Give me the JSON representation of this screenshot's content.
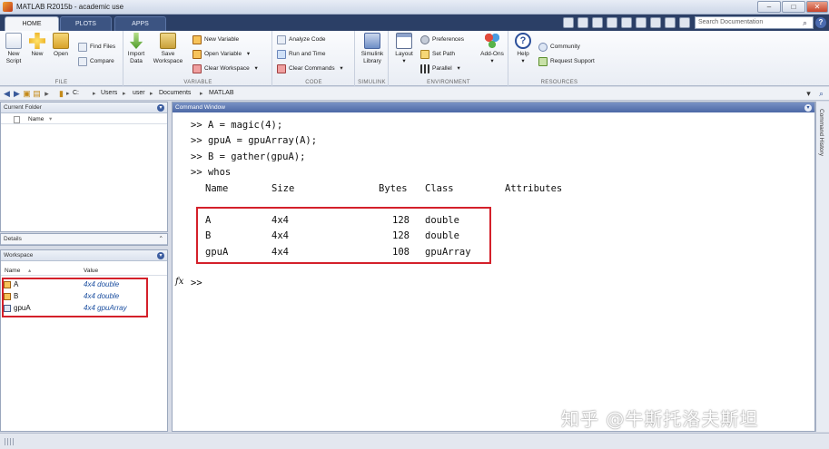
{
  "window": {
    "title": "MATLAB R2015b - academic use",
    "min": "–",
    "max": "□",
    "close": "✕"
  },
  "tabs": [
    {
      "label": "HOME"
    },
    {
      "label": "PLOTS"
    },
    {
      "label": "APPS"
    }
  ],
  "search": {
    "placeholder": "Search Documentation",
    "help": "?"
  },
  "ribbon": {
    "file": {
      "label": "FILE",
      "new_script": "New\nScript",
      "new": "New",
      "open": "Open",
      "find_files": "Find Files",
      "compare": "Compare"
    },
    "variable": {
      "label": "VARIABLE",
      "import_data": "Import\nData",
      "save_workspace": "Save\nWorkspace",
      "new_variable": "New Variable",
      "open_variable": "Open Variable",
      "clear_workspace": "Clear Workspace"
    },
    "code": {
      "label": "CODE",
      "analyze_code": "Analyze Code",
      "run_and_time": "Run and Time",
      "clear_commands": "Clear Commands"
    },
    "simulink": {
      "label": "SIMULINK",
      "library": "Simulink\nLibrary"
    },
    "environment": {
      "label": "ENVIRONMENT",
      "layout": "Layout",
      "preferences": "Preferences",
      "set_path": "Set Path",
      "parallel": "Parallel",
      "add_ons": "Add-Ons"
    },
    "resources": {
      "label": "RESOURCES",
      "help": "Help",
      "community": "Community",
      "request_support": "Request Support"
    }
  },
  "address": {
    "crumbs": [
      "C:",
      "Users",
      "user",
      "Documents",
      "MATLAB"
    ]
  },
  "current_folder": {
    "title": "Current Folder",
    "col_name": "Name"
  },
  "details": {
    "title": "Details"
  },
  "workspace": {
    "title": "Workspace",
    "col_name": "Name",
    "col_value": "Value",
    "rows": [
      {
        "name": "A",
        "value": "4x4 double"
      },
      {
        "name": "B",
        "value": "4x4 double"
      },
      {
        "name": "gpuA",
        "value": "4x4 gpuArray"
      }
    ]
  },
  "command_window": {
    "title": "Command Window",
    "lines": [
      ">> A = magic(4);",
      ">> gpuA = gpuArray(A);",
      ">> B = gather(gpuA);",
      ">> whos"
    ],
    "headers": {
      "name": "Name",
      "size": "Size",
      "bytes": "Bytes",
      "class": "Class",
      "attributes": "Attributes"
    },
    "rows": [
      {
        "name": "A",
        "size": "4x4",
        "bytes": "128",
        "class": "double"
      },
      {
        "name": "B",
        "size": "4x4",
        "bytes": "128",
        "class": "double"
      },
      {
        "name": "gpuA",
        "size": "4x4",
        "bytes": "108",
        "class": "gpuArray"
      }
    ],
    "fx": "fx",
    "prompt": ">>"
  },
  "history": {
    "label": "Command History"
  },
  "watermark": "知乎 @牛斯托洛夫斯坦",
  "colors": {
    "highlight": "#d4202a",
    "value_text": "#1c4fa0"
  }
}
